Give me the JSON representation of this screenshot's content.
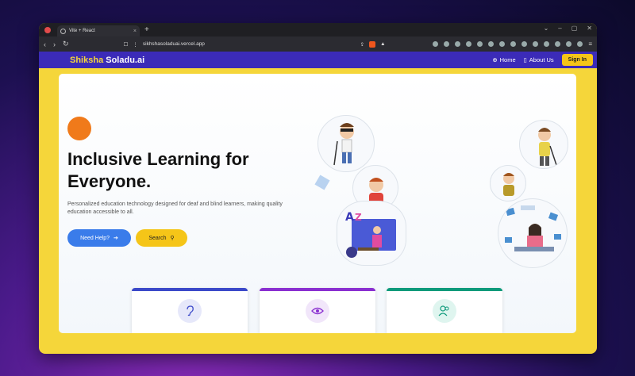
{
  "browser": {
    "tab_title": "Vite + React",
    "url": "sikhshasoladuai.vercel.app"
  },
  "nav": {
    "logo_accent": "Shiksha",
    "logo_main": "Soladu.ai",
    "links": [
      "Home",
      "About Us"
    ],
    "signin": "Sign In"
  },
  "hero": {
    "title": "Inclusive Learning for Everyone.",
    "description": "Personalized education technology designed for deaf and blind learners, making quality education accessible to all.",
    "help_button": "Need Help?",
    "search_button": "Search"
  },
  "cards": [
    {
      "icon": "ear-icon",
      "color": "#3b49c9"
    },
    {
      "icon": "eye-icon",
      "color": "#8a2fd0"
    },
    {
      "icon": "users-icon",
      "color": "#0e9a7b"
    }
  ],
  "colors": {
    "navbar": "#3b2bb8",
    "accent_yellow": "#f5d63a",
    "button_blue": "#3a7cea",
    "orange": "#f07a1a"
  }
}
